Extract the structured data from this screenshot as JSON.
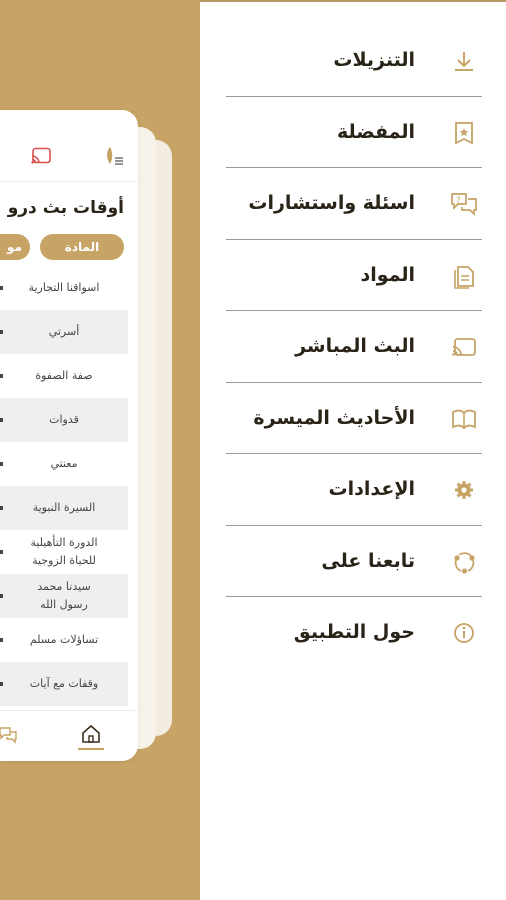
{
  "colors": {
    "brand": "#c7a366",
    "text": "#2a2418",
    "cast_red": "#d9534f"
  },
  "card": {
    "title": "أوقات بث درو",
    "col_subject": "المادة",
    "col_time": "مو",
    "rows": [
      "اسواقنا التجارية",
      "أسرتي",
      "صفة الصفوة",
      "قدوات",
      "معنتي",
      "السيرة النبوية",
      "الدورة التأهيلية للحياة الزوجية",
      "سيدنا محمد رسول الله",
      "تساؤلات مسلم",
      "وقفات مع آيات"
    ],
    "icons": {
      "top_left": "cast-icon",
      "top_right": "menu-logo-icon",
      "bottom_home": "home-icon",
      "bottom_chat": "chat-icon"
    }
  },
  "menu": {
    "items": [
      {
        "label": "التنزيلات",
        "icon": "download-icon"
      },
      {
        "label": "المفضلة",
        "icon": "bookmark-star-icon"
      },
      {
        "label": "اسئلة واستشارات",
        "icon": "question-chat-icon"
      },
      {
        "label": "المواد",
        "icon": "document-icon"
      },
      {
        "label": "البث المباشر",
        "icon": "cast-icon"
      },
      {
        "label": "الأحاديث الميسرة",
        "icon": "book-icon"
      },
      {
        "label": "الإعدادات",
        "icon": "gear-icon"
      },
      {
        "label": "تابعنا على",
        "icon": "share-network-icon"
      },
      {
        "label": "حول التطبيق",
        "icon": "info-icon"
      }
    ]
  }
}
